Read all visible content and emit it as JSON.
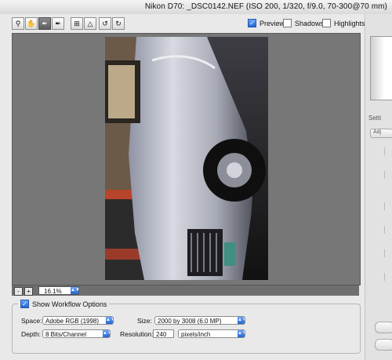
{
  "window": {
    "title": "Nikon D70:  _DSC0142.NEF  (ISO 200, 1/320, f/9.0, 70-300@70 mm)"
  },
  "toolbar": {
    "tools": [
      "zoom-icon",
      "hand-icon",
      "white-balance-icon",
      "color-sampler-icon",
      "crop-icon",
      "straighten-icon",
      "rotate-left-icon",
      "rotate-right-icon"
    ],
    "preview": {
      "label": "Preview",
      "checked": true
    },
    "shadows": {
      "label": "Shadows",
      "checked": false
    },
    "highlights": {
      "label": "Highlights",
      "checked": false
    }
  },
  "zoom": {
    "minus": "-",
    "plus": "+",
    "value": "16.1%"
  },
  "workflow": {
    "show_label": "Show Workflow Options",
    "checked": true,
    "space_label": "Space:",
    "space_value": "Adobe RGB (1998)",
    "depth_label": "Depth:",
    "depth_value": "8 Bits/Channel",
    "size_label": "Size:",
    "size_value": "2000 by 3008  (6.0 MP)",
    "resolution_label": "Resolution:",
    "resolution_value": "240",
    "resolution_unit": "pixels/inch"
  },
  "right_panel": {
    "settings_label": "Setti",
    "adjust_tab": "Adj"
  },
  "colors": {
    "canvas_bg": "#777777",
    "accent": "#2366d1"
  }
}
